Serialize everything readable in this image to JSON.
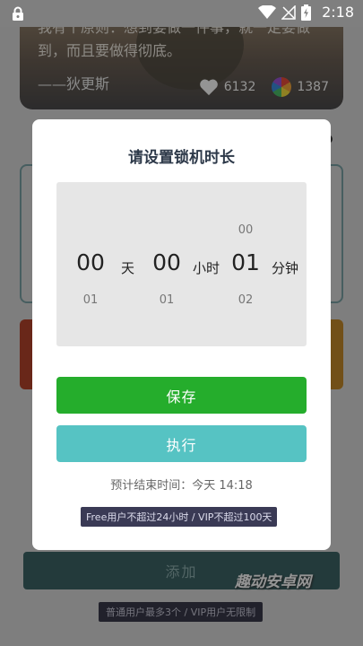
{
  "status_bar": {
    "time": "2:18"
  },
  "background": {
    "quote": {
      "text": "我有个原则：想到要做一件事，就一定要做到，而且要做得彻底。",
      "author": "——狄更斯",
      "likes": "6132",
      "color_count": "1387"
    },
    "add_button_label": "添加",
    "limit_note": "普通用户最多3个 / VIP用户无限制",
    "watermark": "趣动安卓网"
  },
  "dialog": {
    "title": "请设置锁机时长",
    "picker": {
      "days": {
        "above": "",
        "value": "00",
        "below": "01",
        "unit": "天"
      },
      "hours": {
        "above": "",
        "value": "00",
        "below": "01",
        "unit": "小时"
      },
      "minutes": {
        "above": "00",
        "value": "01",
        "below": "02",
        "unit": "分钟"
      }
    },
    "save_label": "保存",
    "execute_label": "执行",
    "end_time": "预计结束时间：今天 14:18",
    "limit_badge": "Free用户不超过24小时 / VIP不超过100天"
  },
  "colors": {
    "save_button": "#25ad2c",
    "execute_button": "#56c3c3",
    "title_text": "#2e3a4a"
  }
}
